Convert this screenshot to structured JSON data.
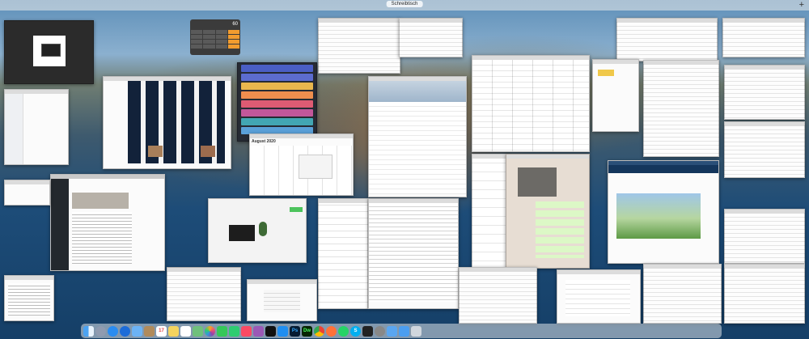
{
  "space_bar": {
    "current_space": "Schreibtisch",
    "add_label": "+"
  },
  "calculator": {
    "display": "60"
  },
  "calendar": {
    "month_title": "August 2020"
  },
  "dock": {
    "icons": [
      "finder-icon",
      "launchpad-icon",
      "safari-icon",
      "1password-icon",
      "mail-icon",
      "contacts-icon",
      "calendar-icon",
      "notes-icon",
      "reminders-icon",
      "maps-icon",
      "photos-icon",
      "messages-icon",
      "facetime-icon",
      "music-icon",
      "podcasts-icon",
      "tv-icon",
      "app-store-icon",
      "photoshop-icon",
      "dreamweaver-icon",
      "chrome-icon",
      "firefox-icon",
      "whatsapp-icon",
      "skype-icon",
      "terminal-icon",
      "system-preferences-icon",
      "folder-icon",
      "downloads-icon",
      "trash-icon"
    ],
    "labels": {
      "photoshop": "Ps",
      "dreamweaver": "Dw",
      "skype": "S",
      "calendar_day": "17"
    }
  },
  "colors": {
    "dock_bg": "#dce1e8",
    "calc_op": "#f29c2f"
  }
}
